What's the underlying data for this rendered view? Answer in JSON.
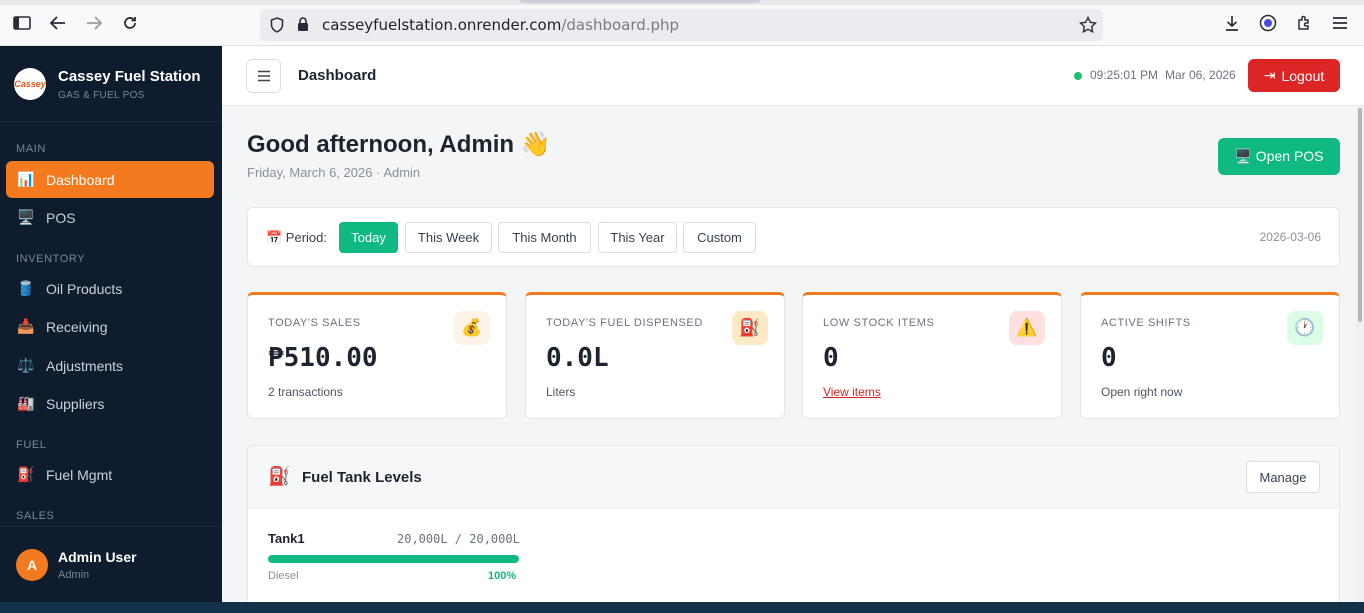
{
  "browser": {
    "url_host": "casseyfuelstation.onrender.com",
    "url_path": "/dashboard.php"
  },
  "sidebar": {
    "brand_name": "Cassey Fuel Station",
    "brand_tagline": "GAS & FUEL POS",
    "logo_text": "Cassey",
    "sections": {
      "main": "MAIN",
      "inventory": "INVENTORY",
      "fuel": "FUEL",
      "sales": "SALES"
    },
    "items": [
      {
        "label": "Dashboard",
        "icon": "📊"
      },
      {
        "label": "POS",
        "icon": "🖥️"
      },
      {
        "label": "Oil Products",
        "icon": "🛢️"
      },
      {
        "label": "Receiving",
        "icon": "📥"
      },
      {
        "label": "Adjustments",
        "icon": "⚖️"
      },
      {
        "label": "Suppliers",
        "icon": "🏭"
      },
      {
        "label": "Fuel Mgmt",
        "icon": "⛽"
      }
    ],
    "user": {
      "initial": "A",
      "name": "Admin User",
      "role": "Admin"
    }
  },
  "header": {
    "title": "Dashboard",
    "time": "09:25:01 PM",
    "date": "Mar 06, 2026",
    "logout_label": "Logout",
    "logout_icon": "⇥"
  },
  "main": {
    "greeting": "Good afternoon, Admin 👋",
    "subtitle": "Friday, March 6, 2026 · Admin",
    "open_pos_label": "🖥️ Open POS",
    "period": {
      "label": "📅 Period:",
      "options": [
        "Today",
        "This Week",
        "This Month",
        "This Year",
        "Custom"
      ],
      "selected": "Today",
      "date": "2026-03-06"
    },
    "cards": [
      {
        "label": "TODAY'S SALES",
        "value": "₱510.00",
        "sub": "2 transactions",
        "icon": "💰",
        "icon_bg": "#fdf3e6"
      },
      {
        "label": "TODAY'S FUEL DISPENSED",
        "value": "0.0L",
        "sub": "Liters",
        "icon": "⛽",
        "icon_bg": "#fde9c4"
      },
      {
        "label": "LOW STOCK ITEMS",
        "value": "0",
        "sub": "View items",
        "icon": "⚠️",
        "icon_bg": "#fde0e0"
      },
      {
        "label": "ACTIVE SHIFTS",
        "value": "0",
        "sub": "Open right now",
        "icon": "🕐",
        "icon_bg": "#dcfce7"
      }
    ],
    "tanks": {
      "title": "Fuel Tank Levels",
      "icon": "⛽",
      "manage_label": "Manage",
      "items": [
        {
          "name": "Tank1",
          "capacity": "20,000L / 20,000L",
          "type": "Diesel",
          "percent_label": "100%",
          "level": 1.0
        }
      ]
    }
  },
  "colors": {
    "sidebar_bg": "#0f1c2e",
    "accent_orange": "#f47a1f",
    "success_green": "#10b981",
    "danger_red": "#dc2626"
  }
}
